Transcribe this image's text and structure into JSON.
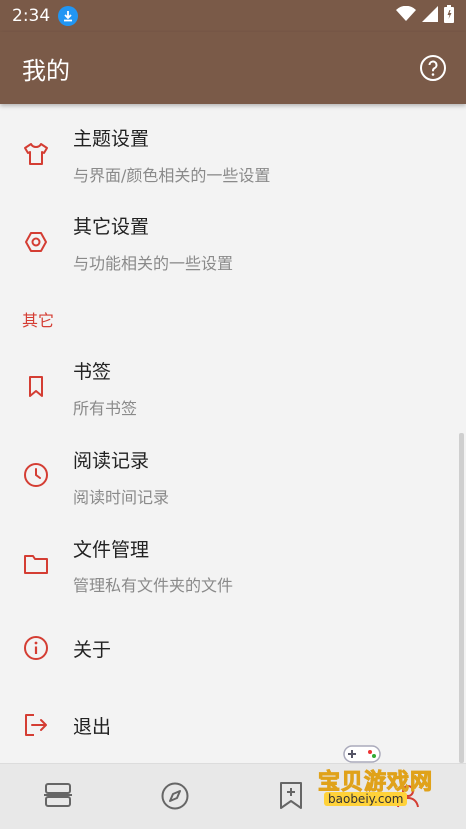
{
  "status_bar": {
    "time": "2:34"
  },
  "app_bar": {
    "title": "我的"
  },
  "settings": [
    {
      "title": "主题设置",
      "subtitle": "与界面/颜色相关的一些设置",
      "icon": "shirt-icon"
    },
    {
      "title": "其它设置",
      "subtitle": "与功能相关的一些设置",
      "icon": "hexagon-settings-icon"
    }
  ],
  "section_other": "其它",
  "other_items": [
    {
      "title": "书签",
      "subtitle": "所有书签",
      "icon": "bookmark-icon"
    },
    {
      "title": "阅读记录",
      "subtitle": "阅读时间记录",
      "icon": "clock-icon"
    },
    {
      "title": "文件管理",
      "subtitle": "管理私有文件夹的文件",
      "icon": "folder-icon"
    },
    {
      "title": "关于",
      "subtitle": "",
      "icon": "info-icon"
    },
    {
      "title": "退出",
      "subtitle": "",
      "icon": "exit-icon"
    }
  ],
  "bottom_nav": [
    {
      "icon": "bookshelf-icon"
    },
    {
      "icon": "compass-icon"
    },
    {
      "icon": "bookmark-add-icon"
    },
    {
      "icon": "profile-icon"
    }
  ],
  "watermark": {
    "text": "宝贝游戏网",
    "url": "baobeiy.com"
  },
  "colors": {
    "app_bar": "#7a5a48",
    "accent": "#d43d33",
    "background": "#f3f3f3"
  }
}
